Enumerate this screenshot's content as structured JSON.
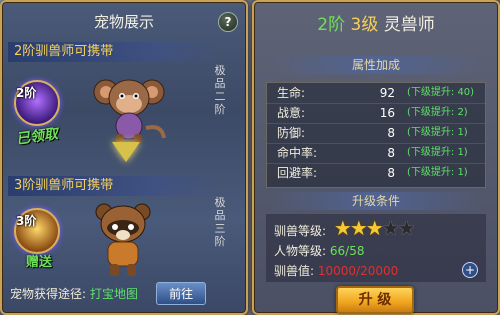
{
  "left_panel": {
    "title": "宠物展示",
    "help_label": "?",
    "tier2": {
      "banner": "2阶驯兽师可携带",
      "badge": "2阶",
      "status": "已领取",
      "grade_label": "极品二阶"
    },
    "tier3": {
      "banner": "3阶驯兽师可携带",
      "badge": "3阶",
      "status": "赠送",
      "grade_label": "极品三阶"
    },
    "footer": {
      "label": "宠物获得途径:",
      "link": "打宝地图",
      "go_button": "前往"
    }
  },
  "right_panel": {
    "title_tier": "2阶",
    "title_level": "3级",
    "title_class": "灵兽师",
    "attributes_header": "属性加成",
    "stats": [
      {
        "label": "生命:",
        "value": "92",
        "bonus": "(下级提升: 40)"
      },
      {
        "label": "战意:",
        "value": "16",
        "bonus": "(下级提升: 2)"
      },
      {
        "label": "防御:",
        "value": "8",
        "bonus": "(下级提升: 1)"
      },
      {
        "label": "命中率:",
        "value": "8",
        "bonus": "(下级提升: 1)"
      },
      {
        "label": "回避率:",
        "value": "8",
        "bonus": "(下级提升: 1)"
      }
    ],
    "upgrade_header": "升级条件",
    "tamer_level_label": "驯兽等级:",
    "tamer_stars": 3,
    "tamer_stars_max": 5,
    "char_level_label": "人物等级:",
    "char_level_value": "66/58",
    "tame_value_label": "驯兽值:",
    "tame_value": "10000/20000",
    "upgrade_button": "升 级"
  },
  "colors": {
    "gold": "#f7d25a",
    "green": "#6ee05a",
    "red": "#e03030"
  }
}
